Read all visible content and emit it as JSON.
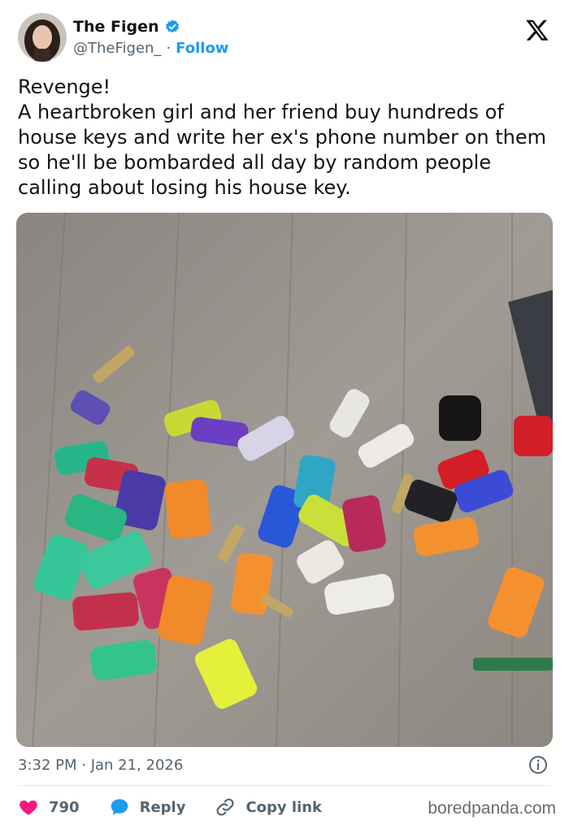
{
  "author": {
    "display_name": "The Figen",
    "handle": "@TheFigen_",
    "separator": "·",
    "follow_label": "Follow"
  },
  "tweet": {
    "text": "Revenge!\nA heartbroken girl and her friend buy hundreds of house keys and write her ex's phone number on them so he'll be bombarded all day by random people calling about losing his house key."
  },
  "timestamp": "3:32 PM · Jan 21, 2026",
  "actions": {
    "like_count": "790",
    "reply_label": "Reply",
    "copy_link_label": "Copy link"
  },
  "watermark": "boredpanda.com",
  "icons": {
    "verified": "verified-badge-icon",
    "x_logo": "x-logo-icon",
    "info": "info-icon",
    "heart": "heart-icon",
    "reply": "reply-bubble-icon",
    "link": "link-icon"
  },
  "colors": {
    "accent": "#1d9bf0",
    "like": "#f91880",
    "secondary_text": "#536471",
    "text": "#0f1419"
  }
}
